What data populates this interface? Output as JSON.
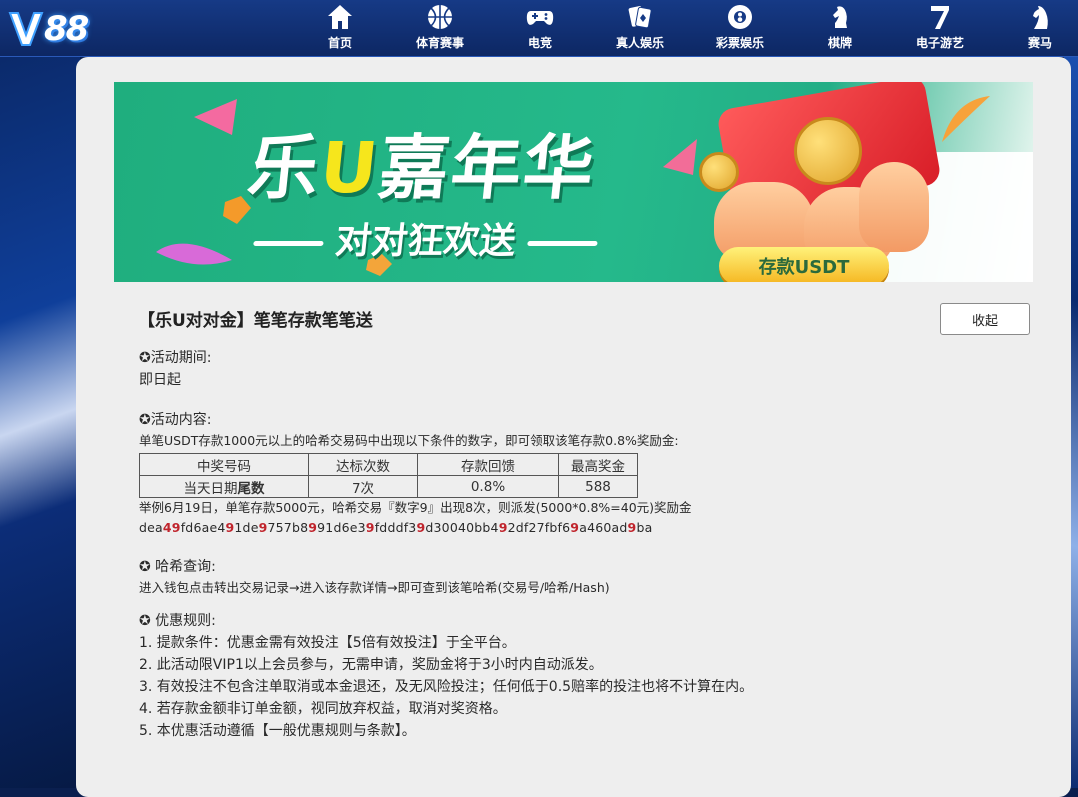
{
  "header": {
    "logo_text": "88",
    "nav": [
      {
        "label": "首页",
        "icon": "home-icon"
      },
      {
        "label": "体育赛事",
        "icon": "basketball-icon"
      },
      {
        "label": "电竞",
        "icon": "gamepad-icon"
      },
      {
        "label": "真人娱乐",
        "icon": "cards-icon"
      },
      {
        "label": "彩票娱乐",
        "icon": "lottery-ball-icon"
      },
      {
        "label": "棋牌",
        "icon": "chess-knight-icon"
      },
      {
        "label": "电子游艺",
        "icon": "slot-seven-icon"
      },
      {
        "label": "赛马",
        "icon": "horse-icon"
      }
    ]
  },
  "banner": {
    "title_pre": "乐",
    "title_u": "U",
    "title_post": "嘉年华",
    "subtitle": "对对狂欢送",
    "button": "存款USDT"
  },
  "promo": {
    "title": "【乐U对对金】笔笔存款笔笔送",
    "collapse_label": "收起",
    "period_label": "✪活动期间:",
    "period_value": "即日起",
    "content_label": "✪活动内容:",
    "content_desc": "单笔USDT存款1000元以上的哈希交易码中出现以下条件的数字，即可领取该笔存款0.8%奖励金:",
    "table": {
      "headers": [
        "中奖号码",
        "达标次数",
        "存款回馈",
        "最高奖金"
      ],
      "row_pre": "当天日期",
      "row_bold": "尾数",
      "row": [
        "7次",
        "0.8%",
        "588"
      ]
    },
    "example": "举例6月19日，单笔存款5000元，哈希交易『数字9』出现8次，则派发(5000*0.8%=40元)奖励金",
    "hash_parts": [
      "dea",
      "4",
      "9",
      "fd6ae4",
      "9",
      "1de",
      "9",
      "757b8",
      "9",
      "91d6e3",
      "9",
      "fdddf3",
      "9",
      "d30040bb4",
      "9",
      "2df27fbf6",
      "9",
      "a460ad",
      "9",
      "ba"
    ],
    "hash_label": "✪ 哈希查询:",
    "hash_desc": "进入钱包点击转出交易记录→进入该存款详情→即可查到该笔哈希(交易号/哈希/Hash)",
    "rules_label": "✪ 优惠规则:",
    "rules": [
      "1. 提款条件：优惠金需有效投注【5倍有效投注】于全平台。",
      "2. 此活动限VIP1以上会员参与，无需申请，奖励金将于3小时内自动派发。",
      "3. 有效投注不包含注单取消或本金退还，及无风险投注；任何低于0.5赔率的投注也将不计算在内。",
      "4. 若存款金额非订单金额，视同放弃权益，取消对奖资格。",
      "5. 本优惠活动遵循【一般优惠规则与条款】。"
    ]
  },
  "colors": {
    "header": "#163a86",
    "panel": "#eeeeee",
    "banner_green": "#25b98b",
    "highlight_red": "#c0242c"
  }
}
